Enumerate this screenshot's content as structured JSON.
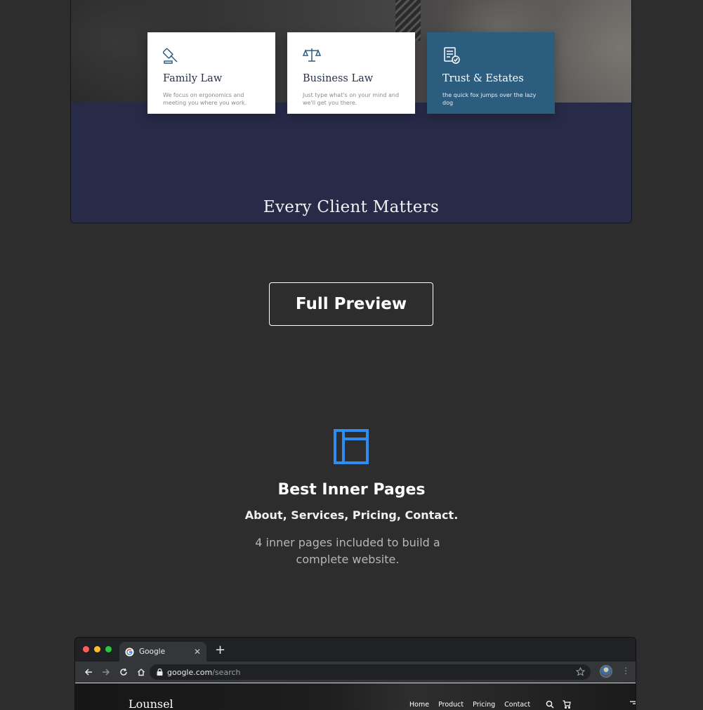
{
  "preview": {
    "cards": [
      {
        "icon": "gavel-icon",
        "title": "Family Law",
        "desc": "We focus on ergonomics and meeting you where you work.",
        "active": false
      },
      {
        "icon": "scales-icon",
        "title": "Business Law",
        "desc": "Just type what's on your mind and we'll get you there.",
        "active": false
      },
      {
        "icon": "document-check-icon",
        "title": "Trust & Estates",
        "desc": "the quick fox jumps over the lazy dog",
        "active": true
      }
    ],
    "heading": "Every Client Matters"
  },
  "full_preview_label": "Full Preview",
  "feature": {
    "icon": "layout-icon",
    "title": "Best Inner Pages",
    "subtitle": "About, Services, Pricing, Contact.",
    "description": "4 inner pages included to build a complete website."
  },
  "browser": {
    "tab_title": "Google",
    "url_host": "google.com",
    "url_path": "/search",
    "site": {
      "logo": "Lounsel",
      "nav": [
        "Home",
        "Product",
        "Pricing",
        "Contact"
      ]
    }
  },
  "colors": {
    "background": "#2d2d2d",
    "navy": "#272b48",
    "card_active": "#2c5d7f",
    "accent_blue": "#2f8cf0",
    "gold": "#d4a536"
  }
}
